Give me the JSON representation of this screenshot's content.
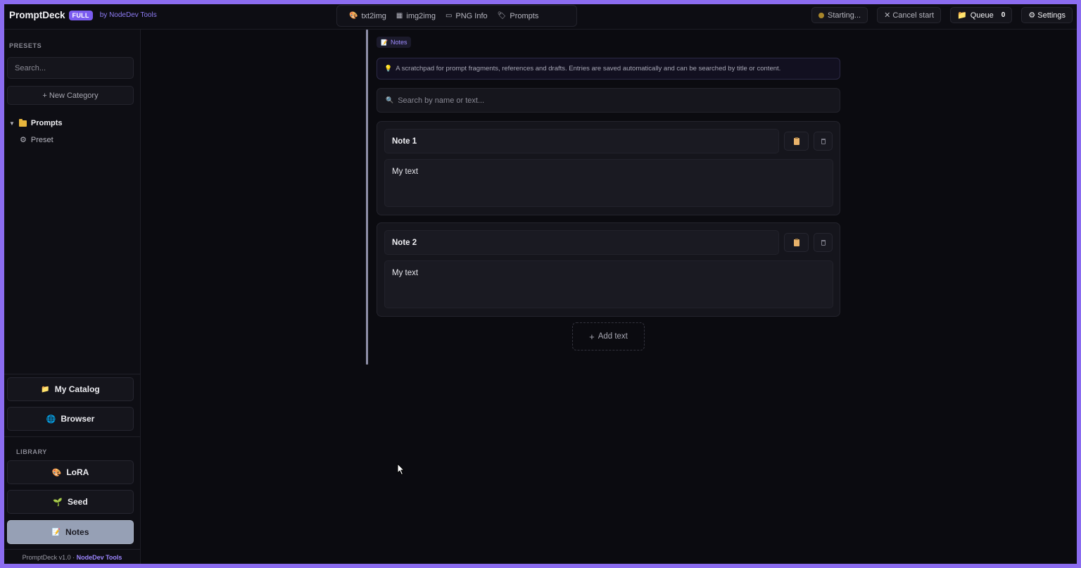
{
  "app": {
    "name": "PromptDeck",
    "edition_badge": "FULL",
    "by_line": "by NodeDev Tools"
  },
  "top_tabs": [
    {
      "icon": "palette-icon",
      "label": "txt2img"
    },
    {
      "icon": "image-icon",
      "label": "img2img"
    },
    {
      "icon": "png-info-icon",
      "label": "PNG Info"
    },
    {
      "icon": "tag-icon",
      "label": "Prompts"
    }
  ],
  "top_right": {
    "status": "Starting...",
    "cancel_label": "✕ Cancel start",
    "queue_label": "Queue",
    "queue_count": "0",
    "settings_label": "⚙ Settings"
  },
  "sidebar": {
    "presets_heading": "PRESETS",
    "search_placeholder": "Search...",
    "new_category_label": "+ New Category",
    "tree": {
      "folder_label": "Prompts",
      "items": [
        {
          "label": "Preset"
        }
      ]
    },
    "catalog_label": "My Catalog",
    "browser_label": "Browser",
    "library_heading": "LIBRARY",
    "library_items": [
      {
        "label": "LoRA",
        "icon": "palette-icon"
      },
      {
        "label": "Seed",
        "icon": "seedling-icon"
      },
      {
        "label": "Notes",
        "icon": "notepad-icon",
        "active": true
      }
    ],
    "footer_version": "PromptDeck v1.0 · ",
    "footer_brand": "NodeDev Tools"
  },
  "main": {
    "section_chip": "Notes",
    "info_text": "A scratchpad for prompt fragments, references and drafts. Entries are saved automatically and can be searched by title or content.",
    "search_placeholder": "Search by name or text...",
    "notes": [
      {
        "title": "Note 1",
        "body": "My text"
      },
      {
        "title": "Note 2",
        "body": "My text"
      }
    ],
    "add_label": "Add text"
  },
  "colors": {
    "accent": "#7b5cf0",
    "frame_border": "#8b6cf0",
    "background": "#0b0b10",
    "active_nav": "#96a0b5",
    "status_dot": "#a8862b"
  }
}
